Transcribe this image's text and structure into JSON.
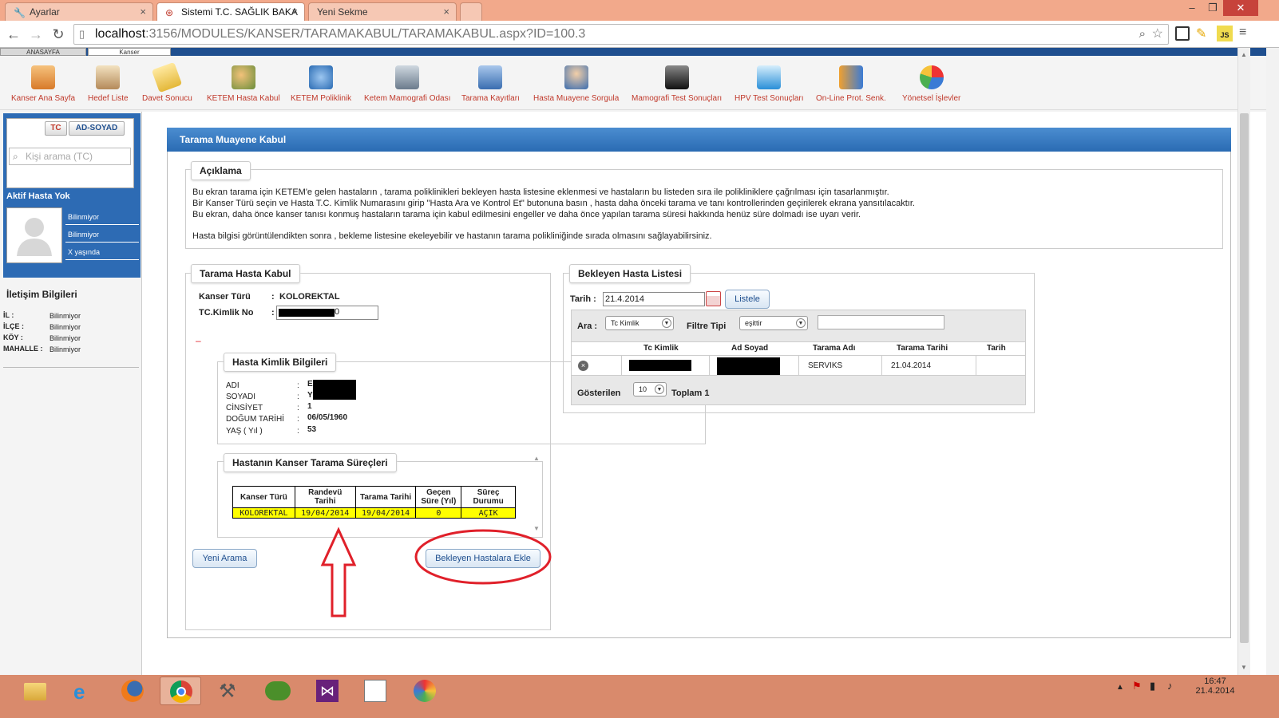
{
  "browser": {
    "tabs": [
      {
        "label": "Ayarlar",
        "icon": "wrench-icon",
        "active": false
      },
      {
        "label": "Sistemi T.C. SAĞLIK BAKA",
        "icon": "ministry-logo-icon",
        "active": true
      },
      {
        "label": "Yeni Sekme",
        "icon": "",
        "active": false
      }
    ],
    "url_host": "localhost",
    "url_path": ":3156/MODULES/KANSER/TARAMAKABUL/TARAMAKABUL.aspx?ID=100.3"
  },
  "app": {
    "top_tabs": [
      "ANASAYFA",
      "Kanser"
    ],
    "toolbar": [
      {
        "label": "Kanser Ana Sayfa",
        "icon": "home-icon"
      },
      {
        "label": "Hedef Liste",
        "icon": "clipboard-icon"
      },
      {
        "label": "Davet Sonucu",
        "icon": "envelope-icon"
      },
      {
        "label": "KETEM Hasta Kabul",
        "icon": "patient-add-icon"
      },
      {
        "label": "KETEM Poliklinik",
        "icon": "stethoscope-icon"
      },
      {
        "label": "Ketem Mamografi Odası",
        "icon": "mammography-icon"
      },
      {
        "label": "Tarama Kayıtları",
        "icon": "records-icon"
      },
      {
        "label": "Hasta Muayene Sorgula",
        "icon": "doctor-icon"
      },
      {
        "label": "Mamografi Test Sonuçları",
        "icon": "xray-icon"
      },
      {
        "label": "HPV Test Sonuçları",
        "icon": "flask-icon"
      },
      {
        "label": "On-Line Prot. Senk.",
        "icon": "sync-arrows-icon"
      },
      {
        "label": "Yönetsel İşlevler",
        "icon": "pie-chart-icon"
      }
    ]
  },
  "sidebar": {
    "btn_tc": "TC",
    "btn_adsoyad": "AD-SOYAD",
    "search_placeholder": "Kişi arama (TC)",
    "active_patient": "Aktif Hasta Yok",
    "patient_info": [
      "Bilinmiyor",
      "Bilinmiyor",
      "X yaşında"
    ],
    "contact_title": "İletişim Bilgileri",
    "contact": [
      {
        "label": "İL :",
        "value": "Bilinmiyor"
      },
      {
        "label": "İLÇE :",
        "value": "Bilinmiyor"
      },
      {
        "label": "KÖY :",
        "value": "Bilinmiyor"
      },
      {
        "label": "MAHALLE :",
        "value": "Bilinmiyor"
      }
    ]
  },
  "main": {
    "panel_title": "Tarama Muayene Kabul",
    "aciklama_title": "Açıklama",
    "aciklama_lines": [
      "Bu ekran tarama için KETEM'e gelen hastaların , tarama poliklinikleri bekleyen hasta listesine eklenmesi ve hastaların bu listeden sıra ile polikliniklere çağrılması için tasarlanmıştır.",
      "Bir Kanser Türü seçin ve Hasta T.C. Kimlik Numarasını girip \"Hasta Ara ve Kontrol Et\" butonuna basın , hasta daha önceki tarama ve tanı kontrollerinden geçirilerek ekrana yansıtılacaktır.",
      "Bu ekran, daha önce kanser tanısı konmuş hastaların tarama için kabul edilmesini engeller ve daha önce yapılan tarama süresi hakkında henüz süre dolmadı ise uyarı verir.",
      "Hasta bilgisi görüntülendikten sonra , bekleme listesine ekeleyebilir ve hastanın tarama polikliniğinde sırada olmasını sağlayabilirsiniz."
    ],
    "kabul": {
      "title": "Tarama Hasta Kabul",
      "kanser_turu_label": "Kanser Türü",
      "kanser_turu_value": "KOLOREKTAL",
      "tc_label": "TC.Kimlik No",
      "tc_value_tail": "0",
      "separator": ":",
      "dash": "–"
    },
    "kimlik": {
      "title": "Hasta Kimlik Bilgileri",
      "fields": [
        {
          "label": "ADI",
          "value": "E"
        },
        {
          "label": "SOYADI",
          "value": "Y"
        },
        {
          "label": "CİNSİYET",
          "value": "1"
        },
        {
          "label": "DOĞUM TARİHİ",
          "value": "06/05/1960"
        },
        {
          "label": "YAŞ ( Yıl )",
          "value": "53"
        }
      ]
    },
    "surec": {
      "title": "Hastanın Kanser Tarama Süreçleri",
      "headers": [
        "Kanser Türü",
        "Randevü Tarihi",
        "Tarama Tarihi",
        "Geçen Süre (Yıl)",
        "Süreç Durumu"
      ],
      "rows": [
        [
          "KOLOREKTAL",
          "19/04/2014",
          "19/04/2014",
          "0",
          "AÇIK"
        ]
      ]
    },
    "btn_yeni_arama": "Yeni Arama",
    "btn_ekle": "Bekleyen Hastalara Ekle",
    "bekleyen": {
      "title": "Bekleyen Hasta Listesi",
      "tarih_label": "Tarih :",
      "tarih_value": "21.4.2014",
      "listele": "Listele",
      "ara_label": "Ara :",
      "ara_select": "Tc Kimlik",
      "filtre_label": "Filtre Tipi",
      "filtre_select": "eşittir",
      "headers": [
        "Tc Kimlik",
        "Ad Soyad",
        "Tarama Adı",
        "Tarama Tarihi",
        "Tarih"
      ],
      "rows": [
        {
          "tarama_adi": "SERVIKS",
          "tarama_tarihi": "21.04.2014",
          "tarih": ""
        }
      ],
      "gosterilen_label": "Gösterilen",
      "gosterilen_value": "10",
      "toplam": "Toplam 1"
    }
  },
  "taskbar": {
    "time": "16:47",
    "date": "21.4.2014"
  },
  "colors": {
    "accent": "#2a6bb3",
    "highlight": "#ffff00",
    "annotation": "#e0202a",
    "taskbar": "#d98a6c"
  }
}
